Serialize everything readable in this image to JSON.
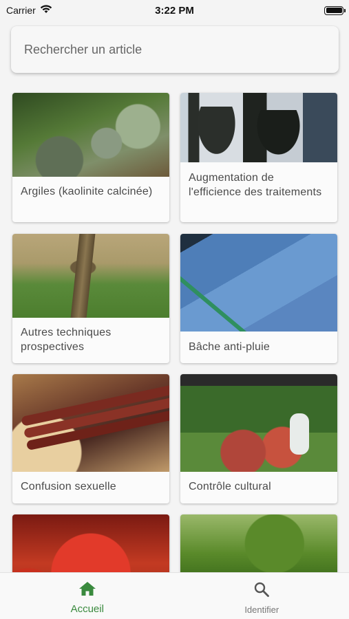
{
  "status_bar": {
    "carrier": "Carrier",
    "time": "3:22 PM",
    "icons": [
      "wifi-icon",
      "battery-icon"
    ]
  },
  "search": {
    "placeholder": "Rechercher un article",
    "value": ""
  },
  "articles": [
    {
      "title": "Argiles (kaolinite calcinée)",
      "image": "leaves-photo"
    },
    {
      "title": "Augmentation de l'efficience des traitements",
      "image": "sprayer-photo"
    },
    {
      "title": "Autres techniques prospectives",
      "image": "orchard-tree-photo"
    },
    {
      "title": "Bâche anti-pluie",
      "image": "rain-cover-photo"
    },
    {
      "title": "Confusion sexuelle",
      "image": "pheromone-dispenser-photo"
    },
    {
      "title": "Contrôle cultural",
      "image": "apples-trap-photo"
    },
    {
      "title": "",
      "image": "apricot-photo"
    },
    {
      "title": "",
      "image": "vine-photo"
    }
  ],
  "bottom_nav": {
    "items": [
      {
        "label": "Accueil",
        "icon": "home-icon",
        "active": true
      },
      {
        "label": "Identifier",
        "icon": "search-icon",
        "active": false
      }
    ],
    "active_color": "#3a8a3e"
  }
}
